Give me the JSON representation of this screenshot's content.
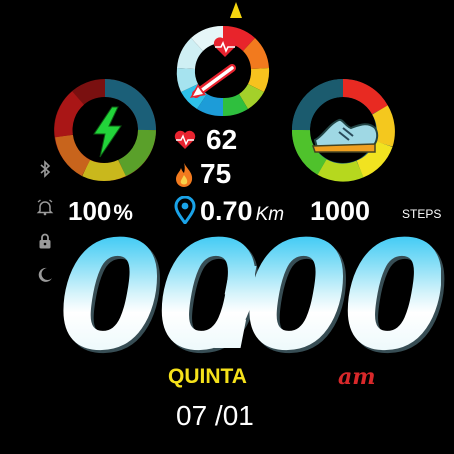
{
  "top_gauge": {
    "icon": "heart-pulse-icon",
    "pointer": "arrow-pointer-icon",
    "level": 0.2
  },
  "battery_ring": {
    "icon": "lightning-bolt-icon",
    "percent_value": 100
  },
  "steps_ring": {
    "icon": "sneaker-icon",
    "level": 0.9
  },
  "stats": {
    "heart_rate": "62",
    "calories": "75",
    "distance": "0.70",
    "distance_unit": "Km",
    "battery": "100",
    "battery_unit": "%",
    "steps": "1000",
    "steps_label": "STEPS"
  },
  "status_icons": [
    "bluetooth-icon",
    "alarm-bell-icon",
    "lock-icon",
    "moon-icon"
  ],
  "time": {
    "hours": "00",
    "separator": ":",
    "minutes": "00",
    "ampm": "am"
  },
  "date": {
    "weekday": "QUINTA",
    "day_month": "07 /01"
  },
  "colors": {
    "weekday": "#f5e11a",
    "ampm": "#d8282a",
    "heart": "#e8232f",
    "flame": "#f39c12",
    "pin": "#1aa3e8"
  }
}
